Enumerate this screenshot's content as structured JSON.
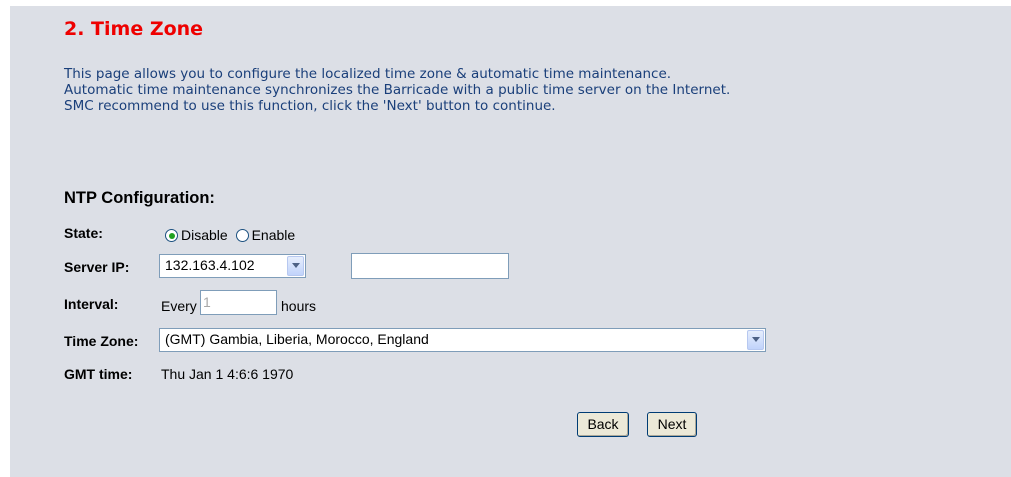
{
  "page": {
    "title": "2. Time Zone",
    "description": "This page allows you to configure the localized time zone & automatic time maintenance. Automatic time maintenance synchronizes the Barricade with a public time server on the Internet. SMC recommend to use this function, click the 'Next' button to continue."
  },
  "ntp": {
    "section_title": "NTP Configuration:",
    "state": {
      "label": "State:",
      "options": [
        "Disable",
        "Enable"
      ],
      "selected": "Disable"
    },
    "server_ip": {
      "label": "Server IP:",
      "selected": "132.163.4.102",
      "manual_value": ""
    },
    "interval": {
      "label": "Interval:",
      "prefix": "Every",
      "value": "1",
      "suffix": "hours"
    },
    "time_zone": {
      "label": "Time Zone:",
      "selected": "(GMT) Gambia, Liberia, Morocco, England"
    },
    "gmt_time": {
      "label": "GMT time:",
      "value": "Thu Jan 1 4:6:6 1970"
    }
  },
  "buttons": {
    "back": "Back",
    "next": "Next"
  },
  "colors": {
    "panel_bg": "#dcdfe6",
    "title": "#ee0000",
    "description": "#1a3f7a"
  }
}
